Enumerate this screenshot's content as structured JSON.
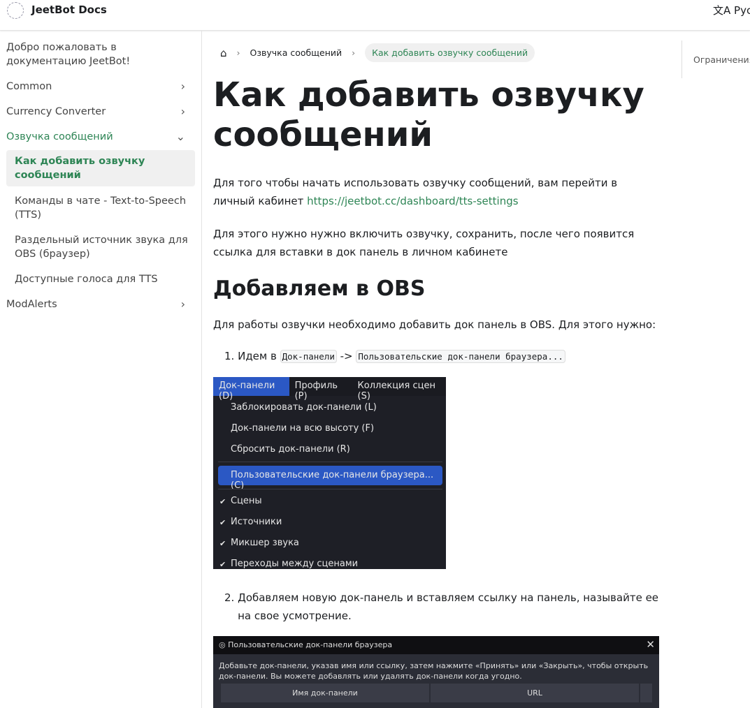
{
  "navbar": {
    "brand": "JeetBot Docs",
    "language": "Русский"
  },
  "sidebar": {
    "items": [
      {
        "label": "Добро пожаловать в документацию JeetBot!"
      },
      {
        "label": "Common"
      },
      {
        "label": "Currency Converter"
      },
      {
        "label": "Озвучка сообщений"
      },
      {
        "label": "Как добавить озвучку сообщений"
      },
      {
        "label": "Команды в чате - Text-to-Speech (TTS)"
      },
      {
        "label": "Раздельный источник звука для OBS (браузер)"
      },
      {
        "label": "Доступные голоса для TTS"
      },
      {
        "label": "ModAlerts"
      }
    ]
  },
  "breadcrumb": {
    "section": "Озвучка сообщений",
    "current": "Как добавить озвучку сообщений"
  },
  "main": {
    "title": "Как добавить озвучку сообщений",
    "p1": "Для того чтобы начать использовать озвучку сообщений, вам перейти в личный кабинет ",
    "p1_link": "https://jeetbot.cc/dashboard/tts-settings",
    "p2": "Для этого нужно нужно включить озвучку, сохранить, после чего появится ссылка для вставки в док панель в личном кабинете",
    "h2": "Добавляем в OBS",
    "p3": "Для работы озвучки необходимо добавить док панель в OBS. Для этого нужно:",
    "step1_prefix": "Идем в ",
    "step1_code1": "Док-панели",
    "step1_arrow": " -> ",
    "step1_code2": "Пользовательские док-панели браузера...",
    "step2": "Добавляем новую док-панель и вставляем ссылку на панель, называйте ее на свое усмотрение."
  },
  "obs_menu": {
    "menubar": [
      "Док-панели (D)",
      "Профиль (P)",
      "Коллекция сцен (S)"
    ],
    "items": [
      "Заблокировать док-панели (L)",
      "Док-панели на всю высоту (F)",
      "Сбросить док-панели (R)",
      "Пользовательские док-панели браузера... (C)",
      "Сцены",
      "Источники",
      "Микшер звука",
      "Переходы между сценами"
    ]
  },
  "obs_dialog": {
    "title": "Пользовательские док-панели браузера",
    "text": "Добавьте док-панели, указав имя или ссылку, затем нажмите «Принять» или «Закрыть», чтобы открыть док-панели. Вы можете добавлять или удалять док-панели когда угодно.",
    "col1": "Имя док-панели",
    "col2": "URL"
  },
  "toc": {
    "item": "Ограничения"
  }
}
